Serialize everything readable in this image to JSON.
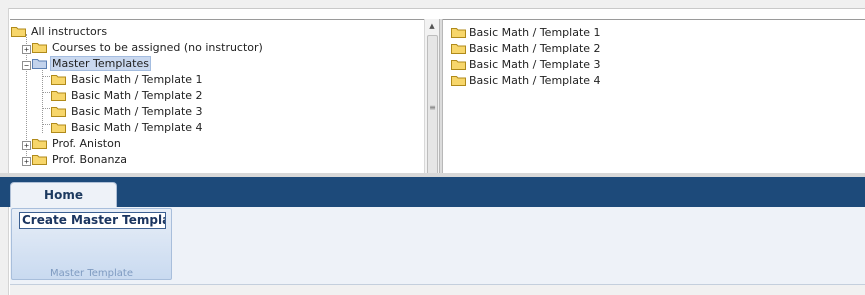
{
  "tree": {
    "root": {
      "label": "All instructors",
      "icon": "folder-icon"
    },
    "nodes": [
      {
        "label": "Courses to be assigned (no instructor)",
        "expander": "+",
        "selected": false
      },
      {
        "label": "Master Templates",
        "expander": "−",
        "selected": true
      },
      {
        "label": "Basic Math / Template 1",
        "expander": "",
        "selected": false
      },
      {
        "label": "Basic Math / Template 2",
        "expander": "",
        "selected": false
      },
      {
        "label": "Basic Math / Template 3",
        "expander": "",
        "selected": false
      },
      {
        "label": "Basic Math / Template 4",
        "expander": "",
        "selected": false
      },
      {
        "label": "Prof. Aniston",
        "expander": "+",
        "selected": false
      },
      {
        "label": "Prof. Bonanza",
        "expander": "+",
        "selected": false
      }
    ]
  },
  "list": {
    "items": [
      "Basic Math / Template 1",
      "Basic Math / Template 2",
      "Basic Math / Template 3",
      "Basic Math / Template 4"
    ]
  },
  "ribbon": {
    "tab_home": "Home",
    "create_button": "Create Master Template",
    "group_caption": "Master Template"
  },
  "colors": {
    "ribbon_bar": "#1d4a7a",
    "folder_fill": "#f7d66b",
    "folder_stroke": "#b08a1a",
    "selection": "#c9d8ef"
  }
}
